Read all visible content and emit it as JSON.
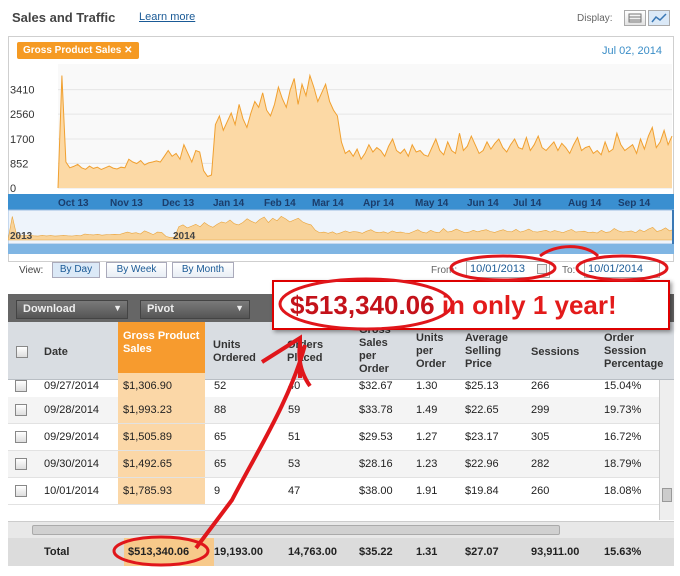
{
  "header": {
    "title": "Sales and Traffic",
    "learn_more": "Learn more",
    "display_label": "Display:",
    "display_icons": [
      "table-icon",
      "chart-icon"
    ]
  },
  "chart_data": {
    "type": "area",
    "metric_tag": "Gross Product Sales",
    "date": "Jul 02, 2014",
    "y_ticks": [
      "3410",
      "2560",
      "1700",
      "852",
      "0"
    ],
    "ylim": [
      0,
      4300
    ],
    "x_ticks": [
      "Oct 13",
      "Nov 13",
      "Dec 13",
      "Jan 14",
      "Feb 14",
      "Mar 14",
      "Apr 14",
      "May 14",
      "Jun 14",
      "Jul 14",
      "Aug 14",
      "Sep 14"
    ],
    "navigator_labels": [
      "2013",
      "2014"
    ],
    "colors": {
      "fill": "#fcd9a5",
      "line": "#f0a030"
    },
    "series": [
      {
        "values": [
          0,
          3900,
          900,
          700,
          750,
          820,
          700,
          650,
          760,
          680,
          720,
          640,
          700,
          760,
          690,
          660,
          720,
          700,
          1000,
          900,
          850,
          950,
          800,
          870,
          900,
          940,
          900,
          1100,
          1300,
          1100,
          1200,
          1000,
          1500,
          1200,
          900,
          1300,
          1250,
          600,
          400,
          450,
          2200,
          2500,
          2000,
          2300,
          2600,
          2200,
          2900,
          2400,
          2100,
          2600,
          3000,
          2800,
          3300,
          2700,
          2500,
          2900,
          3500,
          3100,
          2800,
          3400,
          3800,
          2900,
          3600,
          3200,
          3900,
          3500,
          3000,
          3300,
          3600,
          3000,
          2700,
          2500,
          1600,
          1200,
          1300,
          1100,
          1350,
          1000,
          1200,
          1500,
          1250,
          1400,
          1300,
          1100,
          1450,
          1700,
          1300,
          1200,
          1350,
          1100,
          1500,
          1250,
          1300,
          1150,
          1100,
          1400,
          1700,
          1300,
          1150,
          1600,
          1300,
          1200,
          1900,
          1300,
          1450,
          1800,
          1500,
          1200,
          1300,
          1600,
          1350,
          1550,
          1700,
          1400,
          1250,
          1500,
          1700,
          1400,
          1350,
          1750,
          1300,
          1500,
          1800,
          1400,
          1300,
          1450,
          1600,
          1300,
          1550,
          1400,
          1200,
          1500,
          1750,
          1300,
          1400,
          1450,
          1200,
          1300,
          1150,
          1600,
          1250,
          1350,
          1900,
          1500,
          1300,
          1400,
          1500,
          1200,
          1700,
          1350,
          1800,
          2100,
          1400,
          1600,
          2000,
          1500,
          1800
        ]
      }
    ]
  },
  "view": {
    "label": "View:",
    "buttons": [
      "By Day",
      "By Week",
      "By Month"
    ],
    "active": "By Day",
    "from_label": "From:",
    "from_value": "10/01/2013",
    "to_label": "To:",
    "to_value": "10/01/2014"
  },
  "toolbar": {
    "download": "Download",
    "pivot": "Pivot"
  },
  "table": {
    "headers": [
      "Date",
      "Gross Product Sales",
      "Units Ordered",
      "Orders Placed",
      "Gross Sales per Order",
      "Units per Order",
      "Average Selling Price",
      "Sessions",
      "Order Session Percentage"
    ],
    "rows": [
      [
        "09/27/2014",
        "$1,306.90",
        "52",
        "40",
        "$32.67",
        "1.30",
        "$25.13",
        "266",
        "15.04%"
      ],
      [
        "09/28/2014",
        "$1,993.23",
        "88",
        "59",
        "$33.78",
        "1.49",
        "$22.65",
        "299",
        "19.73%"
      ],
      [
        "09/29/2014",
        "$1,505.89",
        "65",
        "51",
        "$29.53",
        "1.27",
        "$23.17",
        "305",
        "16.72%"
      ],
      [
        "09/30/2014",
        "$1,492.65",
        "65",
        "53",
        "$28.16",
        "1.23",
        "$22.96",
        "282",
        "18.79%"
      ],
      [
        "10/01/2014",
        "$1,785.93",
        "9",
        "47",
        "$38.00",
        "1.91",
        "$19.84",
        "260",
        "18.08%"
      ]
    ],
    "total": [
      "Total",
      "$513,340.06",
      "19,193.00",
      "14,763.00",
      "$35.22",
      "1.31",
      "$27.07",
      "93,911.00",
      "15.63%"
    ]
  },
  "annotation": {
    "big": "$513,340.06",
    "rest": " in only 1 year!",
    "color": "#e31b1b"
  }
}
